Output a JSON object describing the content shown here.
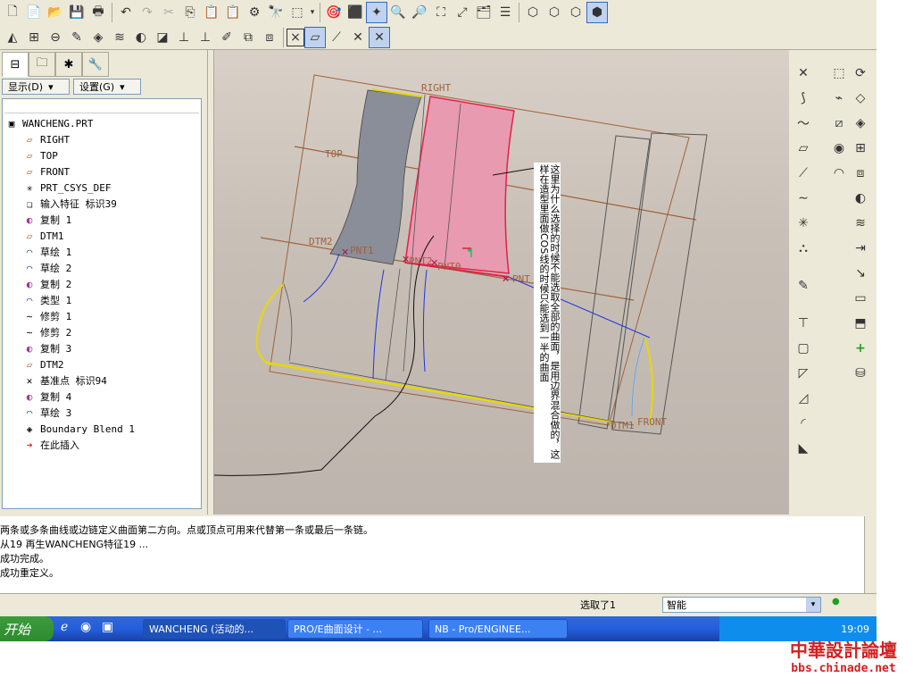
{
  "tree": {
    "display_label": "显示(D)",
    "settings_label": "设置(G)",
    "items": [
      {
        "label": "WANCHENG.PRT",
        "icon": "part-icon"
      },
      {
        "label": "RIGHT",
        "icon": "datum-plane-icon"
      },
      {
        "label": "TOP",
        "icon": "datum-plane-icon"
      },
      {
        "label": "FRONT",
        "icon": "datum-plane-icon"
      },
      {
        "label": "PRT_CSYS_DEF",
        "icon": "csys-icon"
      },
      {
        "label": "输入特征 标识39",
        "icon": "import-feature-icon"
      },
      {
        "label": "复制 1",
        "icon": "copy-surface-icon"
      },
      {
        "label": "DTM1",
        "icon": "datum-plane-icon"
      },
      {
        "label": "草绘 1",
        "icon": "sketch-icon"
      },
      {
        "label": "草绘 2",
        "icon": "sketch-icon"
      },
      {
        "label": "复制 2",
        "icon": "copy-surface-icon"
      },
      {
        "label": "类型 1",
        "icon": "type-icon"
      },
      {
        "label": "修剪 1",
        "icon": "trim-icon"
      },
      {
        "label": "修剪 2",
        "icon": "trim-icon"
      },
      {
        "label": "复制 3",
        "icon": "copy-surface-icon"
      },
      {
        "label": "DTM2",
        "icon": "datum-plane-icon"
      },
      {
        "label": "基准点 标识94",
        "icon": "datum-point-icon"
      },
      {
        "label": "复制 4",
        "icon": "copy-surface-icon"
      },
      {
        "label": "草绘 3",
        "icon": "sketch-icon"
      },
      {
        "label": "Boundary Blend 1",
        "icon": "boundary-blend-icon"
      },
      {
        "label": "在此插入",
        "icon": "insert-here-icon"
      }
    ]
  },
  "viewport": {
    "labels": {
      "right": "RIGHT",
      "top": "TOP",
      "dtm2": "DTM2",
      "pnt1": "PNT1",
      "pnt2": "PNT2",
      "pnt0": "PNT0",
      "pnt": "PNT",
      "dtm1": "DTM1",
      "front": "FRONT"
    },
    "annotation": "这里为什么选择的时候不能选取全部的曲面，是用边界混合做的，这样在造型里面做COS线的时候只能选到一半的曲面"
  },
  "messages": [
    "两条或多条曲线或边链定义曲面第二方向。点或顶点可用来代替第一条或最后一条链。",
    "从19 再生WANCHENG特征19 ...",
    "成功完成。",
    "成功重定义。"
  ],
  "status": {
    "selected": "选取了1",
    "filter": "智能"
  },
  "taskbar": {
    "start": "开始",
    "tasks": [
      "WANCHENG (活动的...",
      "PRO/E曲面设计 - ...",
      "NB - Pro/ENGINEE..."
    ],
    "clock": "19:09"
  },
  "watermark": {
    "title": "中華設計論壇",
    "url": "bbs.chinade.net"
  }
}
